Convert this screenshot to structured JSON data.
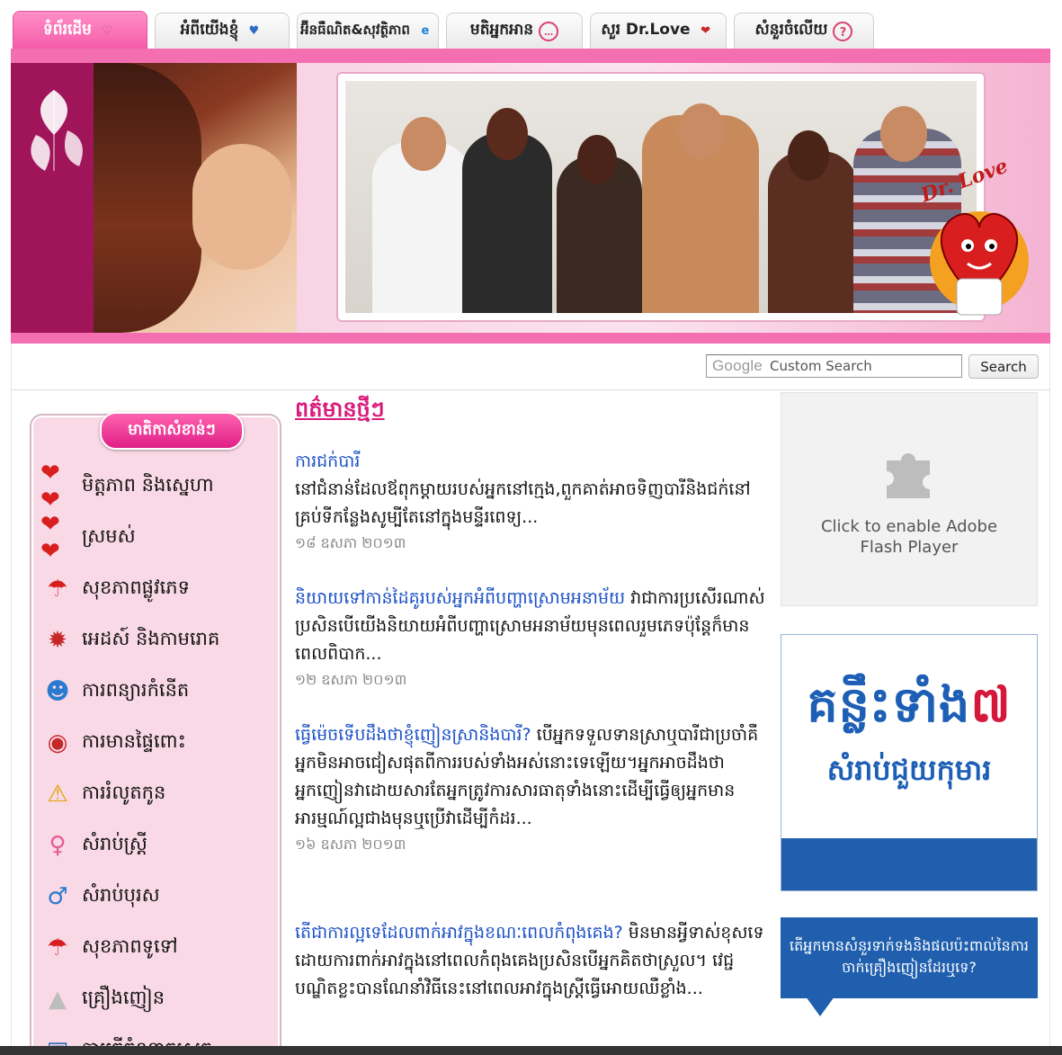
{
  "tabs": [
    {
      "label": "ទំព័រដើម",
      "icon": "heart-face-icon",
      "active": true
    },
    {
      "label": "អំពីយើងខ្ញុំ",
      "icon": "hands-icon",
      "active": false
    },
    {
      "label": "អ៊ីនធឺណិត&សុវត្ថិភាព",
      "icon": "internet-explorer-icon",
      "active": false
    },
    {
      "label": "មតិអ្នកអាន",
      "icon": "chat-bubble-icon",
      "active": false
    },
    {
      "label": "សួរ Dr.Love",
      "icon": "hearts-icon",
      "active": false
    },
    {
      "label": "សំនួរចំលើយ",
      "icon": "question-icon",
      "active": false
    }
  ],
  "banner": {
    "logo_text": "Dr. Love"
  },
  "search": {
    "placeholder_brand": "Google",
    "placeholder": "Custom Search",
    "button_label": "Search"
  },
  "sidebar": {
    "title": "មាតិកាសំខាន់ៗ",
    "items": [
      {
        "label": "មិត្តភាព និងស្នេហា",
        "icon": "heart-pair-icon"
      },
      {
        "label": "ស្រមស់",
        "icon": "heart-pair-icon"
      },
      {
        "label": "សុខភាពផ្លូវភេទ",
        "icon": "strawberry-umbrella-icon"
      },
      {
        "label": "អេដស៍ និងកាមរោគ",
        "icon": "virus-icon"
      },
      {
        "label": "ការពន្យារកំនេីត",
        "icon": "add-person-icon"
      },
      {
        "label": "ការមានផ្ទៃពោះ",
        "icon": "pregnancy-icon"
      },
      {
        "label": "ការរំលូតកូន",
        "icon": "warning-person-icon"
      },
      {
        "label": "សំរាប់ស្ត្រី",
        "icon": "woman-icon"
      },
      {
        "label": "សំរាប់បុរស",
        "icon": "man-icon"
      },
      {
        "label": "សុខភាពទូទៅ",
        "icon": "strawberry-umbrella-icon"
      },
      {
        "label": "គ្រឿងញៀន",
        "icon": "powder-icon"
      },
      {
        "label": "ការធ្វេីចំណាកស្រុក",
        "icon": "backpack-icon"
      }
    ]
  },
  "articles": {
    "heading": "ពត៌មានថ្មីៗ",
    "items": [
      {
        "title": "ការជក់បារី",
        "text": "នៅជំនាន់ដែលឪពុកម្តាយរបស់អ្នកនៅក្មេង,ពួកគាត់អាចទិញបារីនិងជក់នៅគ្រប់ទីកន្លែងសូម្បីតែនៅក្នុងមន្ទីរពេទ្យ...",
        "date": "១៨ ឧសភា ២០១៣"
      },
      {
        "title": "និយាយទៅកាន់ដៃគូរបស់អ្នកអំពីបញ្ហាស្រោមអនាម័យ",
        "text": "វាជាការប្រសេីរណាស់ប្រសិនបេីយេីងនិយាយអំពីបញ្ហាស្រោមអនាម័យមុនពេលរួមភេទប៉ុន្តែក៏មានពេលពិបាក...",
        "date": "១២ ឧសភា ២០១៣"
      },
      {
        "title": "ធ្វេីម៉េចទេីបដឹងថាខ្ញុំញៀនស្រានិងបារី?",
        "text": "បេីអ្នកទទួលទានស្រាឬបារីជាប្រចាំគឺអ្នកមិនអាចជៀសផុតពីការរបស់ទាំងអស់នោះទេឡេីយ។អ្នកអាចដឹងថាអ្នកញៀនវាដោយសារតែអ្នកត្រូវការសារធាតុទាំងនោះដេីម្បីធ្វេីឲ្យអ្នកមានអារម្មណ៍ល្អជាងមុនឬប្រេីវាដេីម្បីកំដរ...",
        "date": "១៦ ឧសភា ២០១៣"
      },
      {
        "title": "តេីជាការល្អទេដែលពាក់អាវក្នុងខណៈពេលកំពុងគេង?",
        "text": "មិនមានអ្វីទាស់ខុសទេ ដោយការពាក់អាវក្នុងនៅពេលកំពុងគេងប្រសិនបេីអ្នកគិតថាស្រួល។ វេជ្ជបណ្ឌិតខ្លះបានណែនាំវិធីនេះនៅពេលអាវក្នុងស្ត្រីធ្វេីអោយឈឺខ្លាំង...",
        "date": ""
      }
    ]
  },
  "right": {
    "flash_text": "Click to enable Adobe Flash Player",
    "ad1_big": "គន្លឹះទាំង",
    "ad1_num": "៧",
    "ad1_sub": "សំរាប់ជួយកុមារ",
    "ad2_text": "តេីអ្នកមានសំនួរទាក់ទងនិងផលប៉ះពាល់នៃការចាក់គ្រឿងញៀនដែរឬទេ?"
  },
  "colors": {
    "accent": "#f46fb2",
    "accent_dark": "#a0155a",
    "link": "#1a4fc6",
    "heading": "#d81b7b",
    "ad_blue": "#1f5fae"
  }
}
